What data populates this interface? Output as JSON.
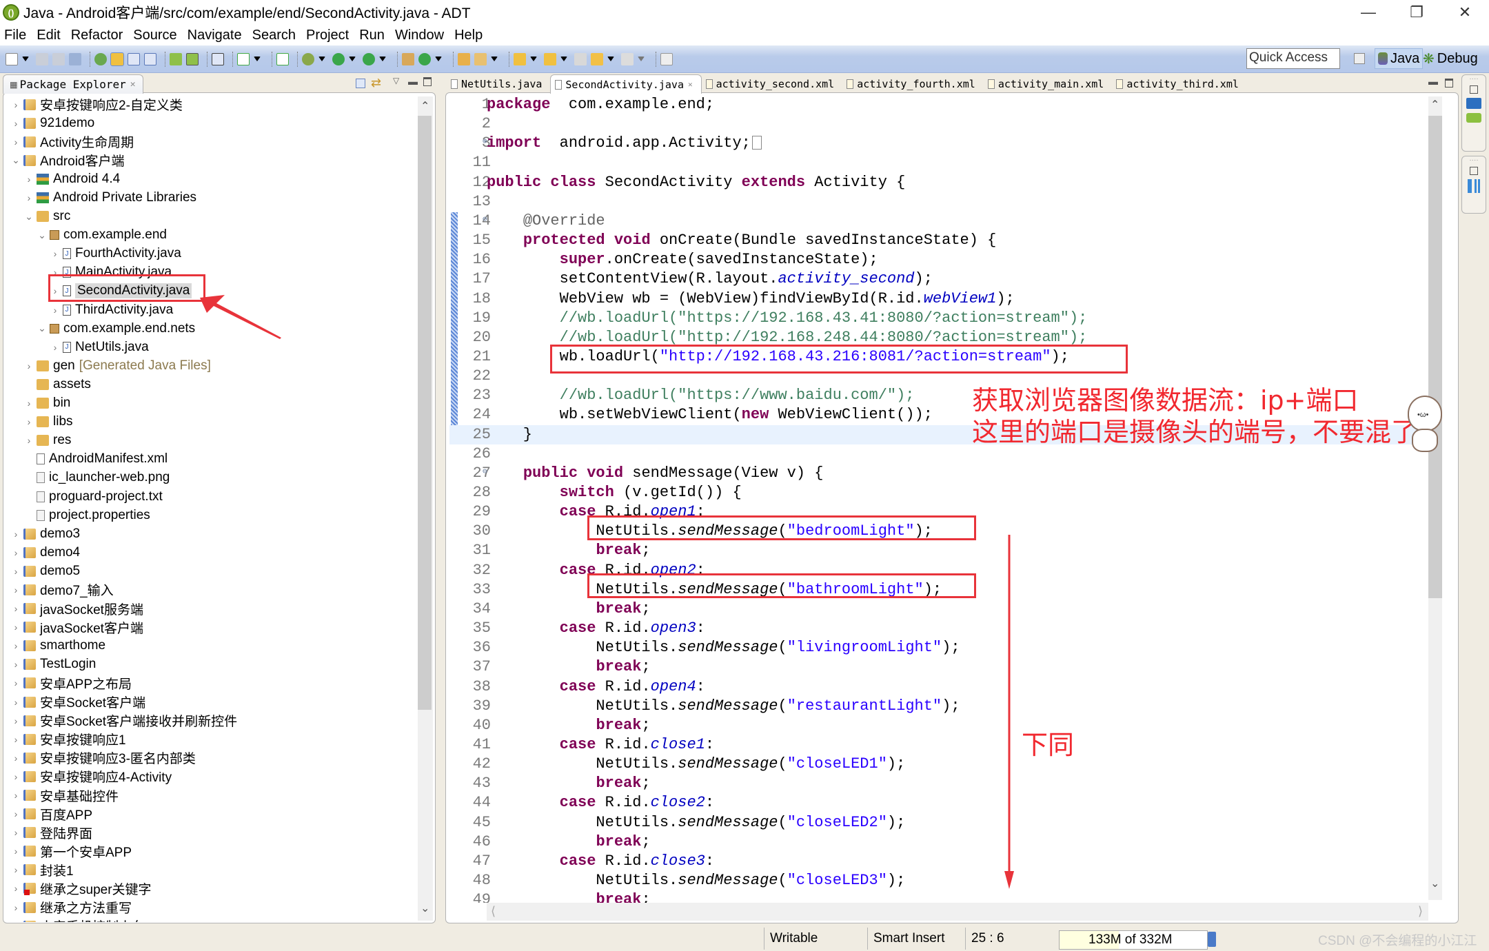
{
  "window": {
    "title": "Java - Android客户端/src/com/example/end/SecondActivity.java - ADT",
    "controls": [
      "minimize",
      "restore",
      "close"
    ]
  },
  "menubar": [
    "File",
    "Edit",
    "Refactor",
    "Source",
    "Navigate",
    "Search",
    "Project",
    "Run",
    "Window",
    "Help"
  ],
  "toolbar": {
    "quick_access": "Quick Access",
    "perspectives": [
      {
        "label": "Java",
        "active": true
      },
      {
        "label": "Debug",
        "active": false
      }
    ]
  },
  "package_explorer": {
    "title": "Package Explorer",
    "items": [
      {
        "label": "安卓按键响应2-自定义类",
        "level": 0,
        "expand": "collapsed",
        "icon": "project"
      },
      {
        "label": "921demo",
        "level": 0,
        "expand": "collapsed",
        "icon": "project"
      },
      {
        "label": "Activity生命周期",
        "level": 0,
        "expand": "collapsed",
        "icon": "project"
      },
      {
        "label": "Android客户端",
        "level": 0,
        "expand": "expanded",
        "icon": "project"
      },
      {
        "label": "Android 4.4",
        "level": 1,
        "expand": "collapsed",
        "icon": "library"
      },
      {
        "label": "Android Private Libraries",
        "level": 1,
        "expand": "collapsed",
        "icon": "library"
      },
      {
        "label": "src",
        "level": 1,
        "expand": "expanded",
        "icon": "source-folder"
      },
      {
        "label": "com.example.end",
        "level": 2,
        "expand": "expanded",
        "icon": "package"
      },
      {
        "label": "FourthActivity.java",
        "level": 3,
        "expand": "collapsed",
        "icon": "java-file"
      },
      {
        "label": "MainActivity.java",
        "level": 3,
        "expand": "collapsed",
        "icon": "java-file"
      },
      {
        "label": "SecondActivity.java",
        "level": 3,
        "expand": "collapsed",
        "icon": "java-file",
        "selected": true
      },
      {
        "label": "ThirdActivity.java",
        "level": 3,
        "expand": "collapsed",
        "icon": "java-file"
      },
      {
        "label": "com.example.end.nets",
        "level": 2,
        "expand": "expanded",
        "icon": "package"
      },
      {
        "label": "NetUtils.java",
        "level": 3,
        "expand": "collapsed",
        "icon": "java-file"
      },
      {
        "label": "gen",
        "suffix": "[Generated Java Files]",
        "level": 1,
        "expand": "collapsed",
        "icon": "source-folder"
      },
      {
        "label": "assets",
        "level": 1,
        "expand": "none",
        "icon": "folder"
      },
      {
        "label": "bin",
        "level": 1,
        "expand": "collapsed",
        "icon": "folder"
      },
      {
        "label": "libs",
        "level": 1,
        "expand": "collapsed",
        "icon": "folder"
      },
      {
        "label": "res",
        "level": 1,
        "expand": "collapsed",
        "icon": "folder"
      },
      {
        "label": "AndroidManifest.xml",
        "level": 1,
        "expand": "none",
        "icon": "xml-file"
      },
      {
        "label": "ic_launcher-web.png",
        "level": 1,
        "expand": "none",
        "icon": "file"
      },
      {
        "label": "proguard-project.txt",
        "level": 1,
        "expand": "none",
        "icon": "file"
      },
      {
        "label": "project.properties",
        "level": 1,
        "expand": "none",
        "icon": "file"
      },
      {
        "label": "demo3",
        "level": 0,
        "expand": "collapsed",
        "icon": "project"
      },
      {
        "label": "demo4",
        "level": 0,
        "expand": "collapsed",
        "icon": "project"
      },
      {
        "label": "demo5",
        "level": 0,
        "expand": "collapsed",
        "icon": "project"
      },
      {
        "label": "demo7_输入",
        "level": 0,
        "expand": "collapsed",
        "icon": "project"
      },
      {
        "label": "javaSocket服务端",
        "level": 0,
        "expand": "collapsed",
        "icon": "project"
      },
      {
        "label": "javaSocket客户端",
        "level": 0,
        "expand": "collapsed",
        "icon": "project"
      },
      {
        "label": "smarthome",
        "level": 0,
        "expand": "collapsed",
        "icon": "project"
      },
      {
        "label": "TestLogin",
        "level": 0,
        "expand": "collapsed",
        "icon": "project"
      },
      {
        "label": "安卓APP之布局",
        "level": 0,
        "expand": "collapsed",
        "icon": "project"
      },
      {
        "label": "安卓Socket客户端",
        "level": 0,
        "expand": "collapsed",
        "icon": "project"
      },
      {
        "label": "安卓Socket客户端接收并刷新控件",
        "level": 0,
        "expand": "collapsed",
        "icon": "project"
      },
      {
        "label": "安卓按键响应1",
        "level": 0,
        "expand": "collapsed",
        "icon": "project"
      },
      {
        "label": "安卓按键响应3-匿名内部类",
        "level": 0,
        "expand": "collapsed",
        "icon": "project"
      },
      {
        "label": "安卓按键响应4-Activity",
        "level": 0,
        "expand": "collapsed",
        "icon": "project"
      },
      {
        "label": "安卓基础控件",
        "level": 0,
        "expand": "collapsed",
        "icon": "project"
      },
      {
        "label": "百度APP",
        "level": 0,
        "expand": "collapsed",
        "icon": "project"
      },
      {
        "label": "登陆界面",
        "level": 0,
        "expand": "collapsed",
        "icon": "project"
      },
      {
        "label": "第一个安卓APP",
        "level": 0,
        "expand": "collapsed",
        "icon": "project"
      },
      {
        "label": "封装1",
        "level": 0,
        "expand": "collapsed",
        "icon": "project"
      },
      {
        "label": "继承之super关键字",
        "level": 0,
        "expand": "collapsed",
        "icon": "project",
        "error": true
      },
      {
        "label": "继承之方法重写",
        "level": 0,
        "expand": "collapsed",
        "icon": "project"
      },
      {
        "label": "小安手机控制小车",
        "level": 0,
        "expand": "collapsed",
        "icon": "project"
      }
    ]
  },
  "editor": {
    "tabs": [
      {
        "label": "NetUtils.java",
        "active": false
      },
      {
        "label": "SecondActivity.java",
        "active": true,
        "closable": true
      },
      {
        "label": "activity_second.xml",
        "active": false
      },
      {
        "label": "activity_fourth.xml",
        "active": false
      },
      {
        "label": "activity_main.xml",
        "active": false
      },
      {
        "label": "activity_third.xml",
        "active": false
      }
    ],
    "current_line": "25",
    "lines": [
      {
        "n": "1",
        "t": [
          [
            "kw",
            "package"
          ],
          [
            "",
            "  com.example.end;"
          ]
        ]
      },
      {
        "n": "2",
        "t": []
      },
      {
        "n": "3",
        "fold": "plus",
        "t": [
          [
            "kw",
            "import"
          ],
          [
            "",
            "  android.app.Activity;"
          ]
        ]
      },
      {
        "n": "11",
        "t": []
      },
      {
        "n": "12",
        "t": [
          [
            "kw",
            "public class"
          ],
          [
            "",
            " SecondActivity "
          ],
          [
            "kw",
            "extends"
          ],
          [
            "",
            " Activity {"
          ]
        ]
      },
      {
        "n": "13",
        "t": []
      },
      {
        "n": "14",
        "fold": "minus",
        "t": [
          [
            "",
            "    "
          ],
          [
            "ann",
            "@Override"
          ]
        ]
      },
      {
        "n": "15",
        "t": [
          [
            "",
            "    "
          ],
          [
            "kw",
            "protected void"
          ],
          [
            "",
            " onCreate(Bundle savedInstanceState) {"
          ]
        ]
      },
      {
        "n": "16",
        "t": [
          [
            "",
            "        "
          ],
          [
            "kw",
            "super"
          ],
          [
            "",
            ".onCreate(savedInstanceState);"
          ]
        ]
      },
      {
        "n": "17",
        "t": [
          [
            "",
            "        setContentView(R.layout."
          ],
          [
            "fld",
            "activity_second"
          ],
          [
            "",
            ");"
          ]
        ]
      },
      {
        "n": "18",
        "t": [
          [
            "",
            "        WebView wb = (WebView)findViewById(R.id."
          ],
          [
            "fld",
            "webView1"
          ],
          [
            "",
            ");"
          ]
        ]
      },
      {
        "n": "19",
        "t": [
          [
            "",
            "        "
          ],
          [
            "cm",
            "//wb.loadUrl(\"https://192.168.43.41:8080/?action=stream\");"
          ]
        ]
      },
      {
        "n": "20",
        "t": [
          [
            "",
            "        "
          ],
          [
            "cm",
            "//wb.loadUrl(\"http://192.168.248.44:8080/?action=stream\");"
          ]
        ]
      },
      {
        "n": "21",
        "t": [
          [
            "",
            "        wb.loadUrl("
          ],
          [
            "str",
            "\"http://192.168.43.216:8081/?action=stream\""
          ],
          [
            "",
            ");"
          ]
        ]
      },
      {
        "n": "22",
        "t": []
      },
      {
        "n": "23",
        "t": [
          [
            "",
            "        "
          ],
          [
            "cm",
            "//wb.loadUrl(\"https://www.baidu.com/\");"
          ]
        ]
      },
      {
        "n": "24",
        "t": [
          [
            "",
            "        wb.setWebViewClient("
          ],
          [
            "kw",
            "new"
          ],
          [
            "",
            " WebViewClient());"
          ]
        ]
      },
      {
        "n": "25",
        "t": [
          [
            "",
            "    }"
          ]
        ]
      },
      {
        "n": "26",
        "t": []
      },
      {
        "n": "27",
        "fold": "minus",
        "t": [
          [
            "",
            "    "
          ],
          [
            "kw",
            "public void"
          ],
          [
            "",
            " sendMessage(View v) {"
          ]
        ]
      },
      {
        "n": "28",
        "t": [
          [
            "",
            "        "
          ],
          [
            "kw",
            "switch"
          ],
          [
            "",
            " (v.getId()) {"
          ]
        ]
      },
      {
        "n": "29",
        "t": [
          [
            "",
            "        "
          ],
          [
            "kw",
            "case"
          ],
          [
            "",
            " R.id."
          ],
          [
            "fld",
            "open1"
          ],
          [
            "",
            ":"
          ]
        ]
      },
      {
        "n": "30",
        "t": [
          [
            "",
            "            NetUtils."
          ],
          [
            "it",
            "sendMessage"
          ],
          [
            "",
            "("
          ],
          [
            "str",
            "\"bedroomLight\""
          ],
          [
            "",
            ");"
          ]
        ]
      },
      {
        "n": "31",
        "t": [
          [
            "",
            "            "
          ],
          [
            "kw",
            "break"
          ],
          [
            "",
            ";"
          ]
        ]
      },
      {
        "n": "32",
        "t": [
          [
            "",
            "        "
          ],
          [
            "kw",
            "case"
          ],
          [
            "",
            " R.id."
          ],
          [
            "fld",
            "open2"
          ],
          [
            "",
            ":"
          ]
        ]
      },
      {
        "n": "33",
        "t": [
          [
            "",
            "            NetUtils."
          ],
          [
            "it",
            "sendMessage"
          ],
          [
            "",
            "("
          ],
          [
            "str",
            "\"bathroomLight\""
          ],
          [
            "",
            ");"
          ]
        ]
      },
      {
        "n": "34",
        "t": [
          [
            "",
            "            "
          ],
          [
            "kw",
            "break"
          ],
          [
            "",
            ";"
          ]
        ]
      },
      {
        "n": "35",
        "t": [
          [
            "",
            "        "
          ],
          [
            "kw",
            "case"
          ],
          [
            "",
            " R.id."
          ],
          [
            "fld",
            "open3"
          ],
          [
            "",
            ":"
          ]
        ]
      },
      {
        "n": "36",
        "t": [
          [
            "",
            "            NetUtils."
          ],
          [
            "it",
            "sendMessage"
          ],
          [
            "",
            "("
          ],
          [
            "str",
            "\"livingroomLight\""
          ],
          [
            "",
            ");"
          ]
        ]
      },
      {
        "n": "37",
        "t": [
          [
            "",
            "            "
          ],
          [
            "kw",
            "break"
          ],
          [
            "",
            ";"
          ]
        ]
      },
      {
        "n": "38",
        "t": [
          [
            "",
            "        "
          ],
          [
            "kw",
            "case"
          ],
          [
            "",
            " R.id."
          ],
          [
            "fld",
            "open4"
          ],
          [
            "",
            ":"
          ]
        ]
      },
      {
        "n": "39",
        "t": [
          [
            "",
            "            NetUtils."
          ],
          [
            "it",
            "sendMessage"
          ],
          [
            "",
            "("
          ],
          [
            "str",
            "\"restaurantLight\""
          ],
          [
            "",
            ");"
          ]
        ]
      },
      {
        "n": "40",
        "t": [
          [
            "",
            "            "
          ],
          [
            "kw",
            "break"
          ],
          [
            "",
            ";"
          ]
        ]
      },
      {
        "n": "41",
        "t": [
          [
            "",
            "        "
          ],
          [
            "kw",
            "case"
          ],
          [
            "",
            " R.id."
          ],
          [
            "fld",
            "close1"
          ],
          [
            "",
            ":"
          ]
        ]
      },
      {
        "n": "42",
        "t": [
          [
            "",
            "            NetUtils."
          ],
          [
            "it",
            "sendMessage"
          ],
          [
            "",
            "("
          ],
          [
            "str",
            "\"closeLED1\""
          ],
          [
            "",
            ");"
          ]
        ]
      },
      {
        "n": "43",
        "t": [
          [
            "",
            "            "
          ],
          [
            "kw",
            "break"
          ],
          [
            "",
            ";"
          ]
        ]
      },
      {
        "n": "44",
        "t": [
          [
            "",
            "        "
          ],
          [
            "kw",
            "case"
          ],
          [
            "",
            " R.id."
          ],
          [
            "fld",
            "close2"
          ],
          [
            "",
            ":"
          ]
        ]
      },
      {
        "n": "45",
        "t": [
          [
            "",
            "            NetUtils."
          ],
          [
            "it",
            "sendMessage"
          ],
          [
            "",
            "("
          ],
          [
            "str",
            "\"closeLED2\""
          ],
          [
            "",
            ");"
          ]
        ]
      },
      {
        "n": "46",
        "t": [
          [
            "",
            "            "
          ],
          [
            "kw",
            "break"
          ],
          [
            "",
            ";"
          ]
        ]
      },
      {
        "n": "47",
        "t": [
          [
            "",
            "        "
          ],
          [
            "kw",
            "case"
          ],
          [
            "",
            " R.id."
          ],
          [
            "fld",
            "close3"
          ],
          [
            "",
            ":"
          ]
        ]
      },
      {
        "n": "48",
        "t": [
          [
            "",
            "            NetUtils."
          ],
          [
            "it",
            "sendMessage"
          ],
          [
            "",
            "("
          ],
          [
            "str",
            "\"closeLED3\""
          ],
          [
            "",
            ");"
          ]
        ]
      },
      {
        "n": "49",
        "t": [
          [
            "",
            "            "
          ],
          [
            "kw",
            "break"
          ],
          [
            "",
            ";"
          ]
        ]
      }
    ]
  },
  "annotations": {
    "note1_line1": "获取浏览器图像数据流：ip+端口",
    "note1_line2": "这里的端口是摄像头的端号，不要混了",
    "note2": "下同",
    "color": "#f1282f"
  },
  "statusbar": {
    "mode": "Writable",
    "insert": "Smart Insert",
    "position": "25 : 6",
    "heap": "133M of 332M",
    "heap_used_fraction": 0.4
  },
  "watermark": "CSDN @不会编程的小江江"
}
